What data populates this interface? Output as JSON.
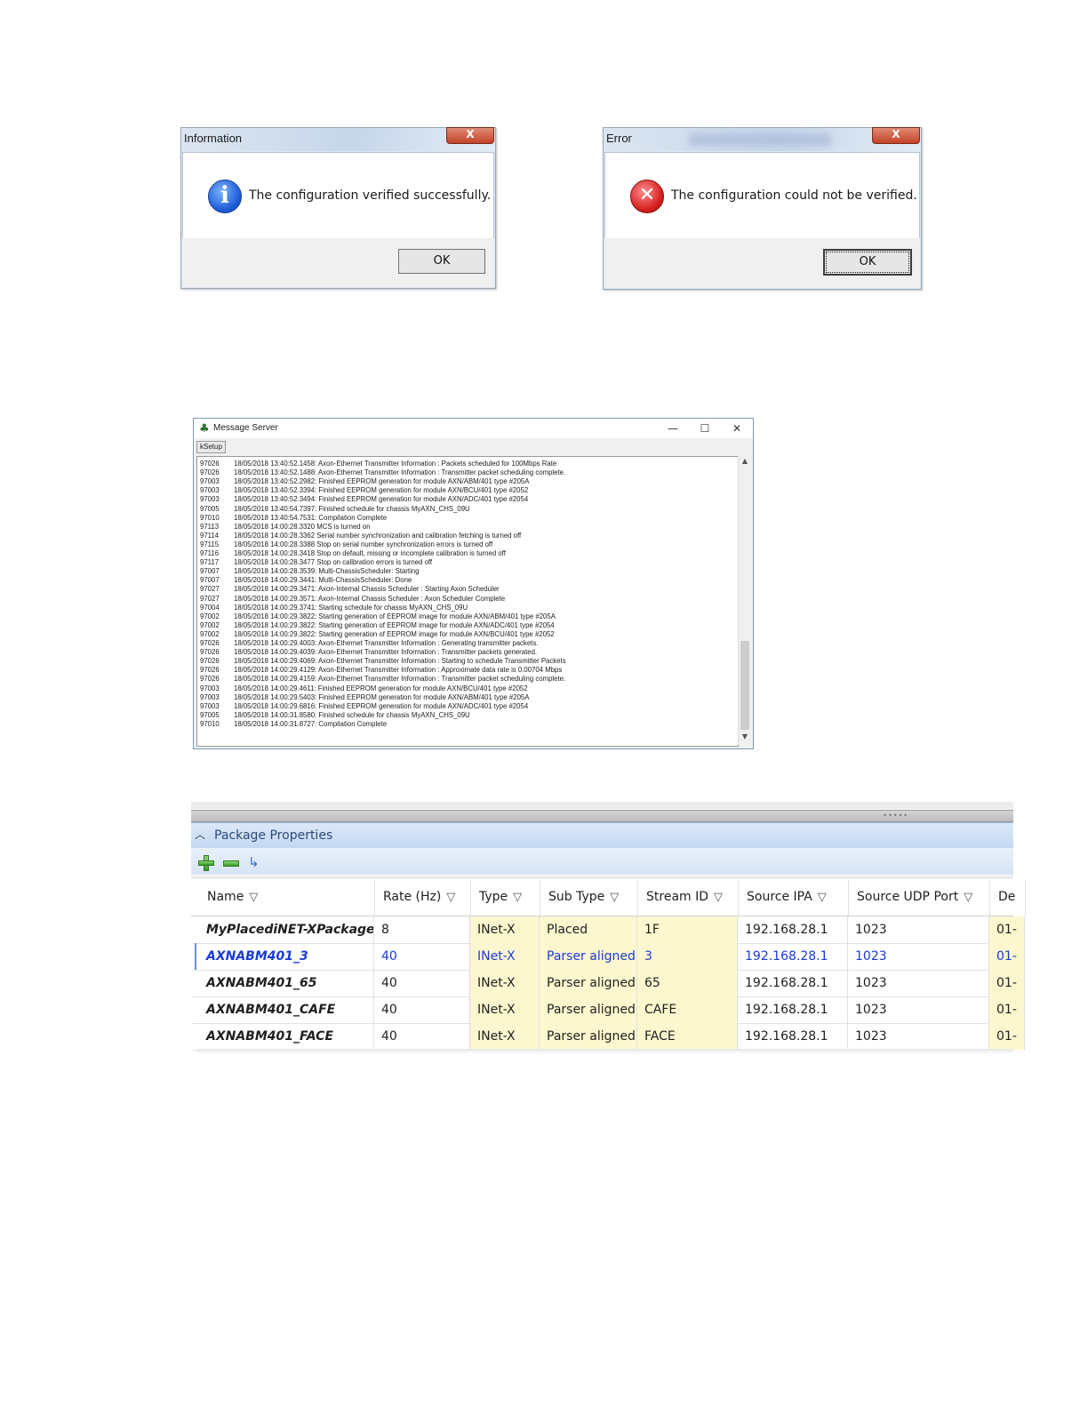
{
  "info_dialog": {
    "title": "Information",
    "close_label": "X",
    "icon": "info-icon",
    "message": "The configuration verified successfully.",
    "ok_label": "OK"
  },
  "error_dialog": {
    "title": "Error",
    "close_label": "X",
    "icon": "error-icon",
    "message": "The configuration could not be verified.",
    "ok_label": "OK"
  },
  "message_server": {
    "title": "Message Server",
    "minimize": "—",
    "maximize": "☐",
    "close": "✕",
    "tab_label": "kSetup",
    "log": [
      {
        "code": "97026",
        "text": "18/05/2018 13:40:52.1458: Axon-Ethernet Transmitter Information : Packets scheduled for 100Mbps Rate"
      },
      {
        "code": "97026",
        "text": "18/05/2018 13:40:52.1488: Axon-Ethernet Transmitter Information : Transmitter packet scheduling complete."
      },
      {
        "code": "97003",
        "text": "18/05/2018 13:40:52.2982: Finished EEPROM generation for module AXN/ABM/401 type #205A"
      },
      {
        "code": "97003",
        "text": "18/05/2018 13:40:52.3394: Finished EEPROM generation for module AXN/BCU/401 type #2052"
      },
      {
        "code": "97003",
        "text": "18/05/2018 13:40:52.3494: Finished EEPROM generation for module AXN/ADC/401 type #2054"
      },
      {
        "code": "97005",
        "text": "18/05/2018 13:40:54.7397: Finished schedule for chassis MyAXN_CHS_09U"
      },
      {
        "code": "97010",
        "text": "18/05/2018 13:40:54.7531: Compilation Complete"
      },
      {
        "code": "97113",
        "text": "18/05/2018 14:00:28.3320 MCS is turned on"
      },
      {
        "code": "97114",
        "text": "18/05/2018 14:00:28.3362 Serial number synchronization and calibration fetching is turned off"
      },
      {
        "code": "97115",
        "text": "18/05/2018 14:00:28.3388 Stop on serial number synchronization errors is turned off"
      },
      {
        "code": "97116",
        "text": "18/05/2018 14:00:28.3418 Stop on default, missing or incomplete calibration is turned off"
      },
      {
        "code": "97117",
        "text": "18/05/2018 14:00:28.3477 Stop on calibration errors is turned off"
      },
      {
        "code": "97007",
        "text": "18/05/2018 14:00:28.3539: Multi-ChassisScheduler: Starting"
      },
      {
        "code": "97007",
        "text": "18/05/2018 14:00:29.3441: Multi-ChassisScheduler: Done"
      },
      {
        "code": "97027",
        "text": "18/05/2018 14:00:29.3471: Axon-Internal Chassis Scheduler : Starting Axon Scheduler"
      },
      {
        "code": "97027",
        "text": "18/05/2018 14:00:29.3571: Axon-Internal Chassis Scheduler : Axon Scheduler Complete"
      },
      {
        "code": "97004",
        "text": "18/05/2018 14:00:29.3741: Starting schedule for chassis MyAXN_CHS_09U"
      },
      {
        "code": "97002",
        "text": "18/05/2018 14:00:29.3822: Starting generation of EEPROM image for module AXN/ABM/401 type #205A"
      },
      {
        "code": "97002",
        "text": "18/05/2018 14:00:29.3822: Starting generation of EEPROM image for module AXN/ADC/401 type #2054"
      },
      {
        "code": "97002",
        "text": "18/05/2018 14:00:29.3822: Starting generation of EEPROM image for module AXN/BCU/401 type #2052"
      },
      {
        "code": "97026",
        "text": "18/05/2018 14:00:29.4003: Axon-Ethernet Transmitter Information : Generating transmitter packets."
      },
      {
        "code": "97026",
        "text": "18/05/2018 14:00:29.4039: Axon-Ethernet Transmitter Information : Transmitter packets generated."
      },
      {
        "code": "97026",
        "text": "18/05/2018 14:00:29.4069: Axon-Ethernet Transmitter Information : Starting to schedule Transmitter Packets"
      },
      {
        "code": "97026",
        "text": "18/05/2018 14:00:29.4129: Axon-Ethernet Transmitter Information : Approximate data rate is 0.00704 Mbps"
      },
      {
        "code": "97026",
        "text": "18/05/2018 14:00:29.4159: Axon-Ethernet Transmitter Information : Transmitter packet scheduling complete."
      },
      {
        "code": "97003",
        "text": "18/05/2018 14:00:29.4611: Finished EEPROM generation for module AXN/BCU/401 type #2052"
      },
      {
        "code": "97003",
        "text": "18/05/2018 14:00:29.5403: Finished EEPROM generation for module AXN/ABM/401 type #205A"
      },
      {
        "code": "97003",
        "text": "18/05/2018 14:00:29.6816: Finished EEPROM generation for module AXN/ADC/401 type #2054"
      },
      {
        "code": "97005",
        "text": "18/05/2018 14:00:31.8580: Finished schedule for chassis MyAXN_CHS_09U"
      },
      {
        "code": "97010",
        "text": "18/05/2018 14:00:31.8727: Compilation Complete"
      }
    ]
  },
  "package_properties": {
    "title": "Package Properties",
    "toolbar": [
      "add-icon",
      "remove-icon",
      "link-icon"
    ],
    "columns": [
      "Name",
      "Rate (Hz)",
      "Type",
      "Sub Type",
      "Stream ID",
      "Source IPA",
      "Source UDP Port",
      "De"
    ],
    "rows": [
      [
        "MyPlacediNET-XPackage",
        "8",
        "INet-X",
        "Placed",
        "1F",
        "192.168.28.1",
        "1023",
        "01-"
      ],
      [
        "AXNABM401_3",
        "40",
        "INet-X",
        "Parser aligned",
        "3",
        "192.168.28.1",
        "1023",
        "01-"
      ],
      [
        "AXNABM401_65",
        "40",
        "INet-X",
        "Parser aligned",
        "65",
        "192.168.28.1",
        "1023",
        "01-"
      ],
      [
        "AXNABM401_CAFE",
        "40",
        "INet-X",
        "Parser aligned",
        "CAFE",
        "192.168.28.1",
        "1023",
        "01-"
      ],
      [
        "AXNABM401_FACE",
        "40",
        "INet-X",
        "Parser aligned",
        "FACE",
        "192.168.28.1",
        "1023",
        "01-"
      ]
    ],
    "highlight_color": "#fdf7cf",
    "selected_color": "#1a3ad6"
  }
}
